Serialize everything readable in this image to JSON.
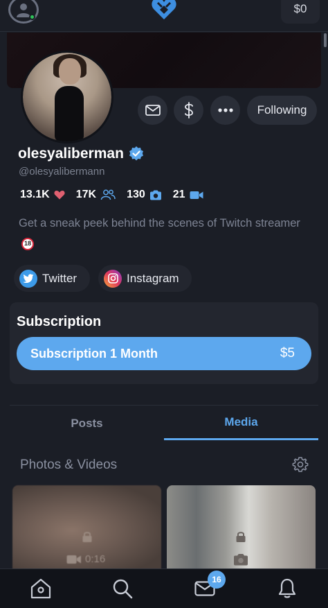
{
  "header": {
    "balance": "$0",
    "icons": {
      "avatar": "user-avatar-icon",
      "logo": "heart-logo-icon"
    }
  },
  "profile": {
    "name": "olesyaliberman",
    "handle": "@olesyalibermann",
    "verified": true,
    "follow_label": "Following",
    "stats": {
      "likes": "13.1K",
      "fans": "17K",
      "photos": "130",
      "videos": "21"
    },
    "bio": "Get a sneak peek behind the scenes of Twitch streamer"
  },
  "social": {
    "twitter": "Twitter",
    "instagram": "Instagram"
  },
  "subscription": {
    "title": "Subscription",
    "button_label": "Subscription 1 Month",
    "price": "$5"
  },
  "tabs": [
    {
      "label": "Posts",
      "active": false
    },
    {
      "label": "Media",
      "active": true
    }
  ],
  "media": {
    "section_title": "Photos & Videos",
    "items": [
      {
        "type": "video",
        "duration": "0:16",
        "locked": true
      },
      {
        "type": "photo",
        "locked": true
      }
    ]
  },
  "bottom_nav": {
    "items": [
      "home",
      "search",
      "messages",
      "notifications"
    ],
    "messages_badge": "16"
  },
  "colors": {
    "accent": "#5da8ee",
    "background": "#1b1e26",
    "card": "#23262f",
    "like": "#e06070",
    "online": "#2ec55a"
  }
}
